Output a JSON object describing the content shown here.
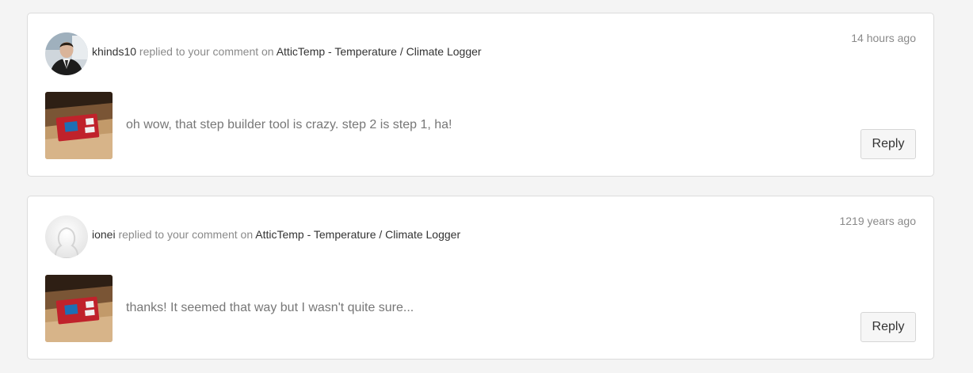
{
  "notifications": [
    {
      "user": "khinds10",
      "action_text": " replied to your comment on ",
      "project": "AtticTemp - Temperature / Climate Logger",
      "time": "14 hours ago",
      "message": "oh wow, that step builder tool is crazy. step 2 is step 1, ha!",
      "reply_label": "Reply",
      "avatar": "user-photo-avatar"
    },
    {
      "user": "ionei",
      "action_text": " replied to your comment on ",
      "project": "AtticTemp - Temperature / Climate Logger",
      "time": "1219 years ago",
      "message": "thanks! It seemed that way but I wasn't quite sure...",
      "reply_label": "Reply",
      "avatar": "default-avatar"
    }
  ],
  "colors": {
    "background": "#f4f4f4",
    "card": "#ffffff",
    "border": "#dcdcdc",
    "muted_text": "#8a8a8a",
    "dark_text": "#333333",
    "device_red": "#c0222b"
  }
}
